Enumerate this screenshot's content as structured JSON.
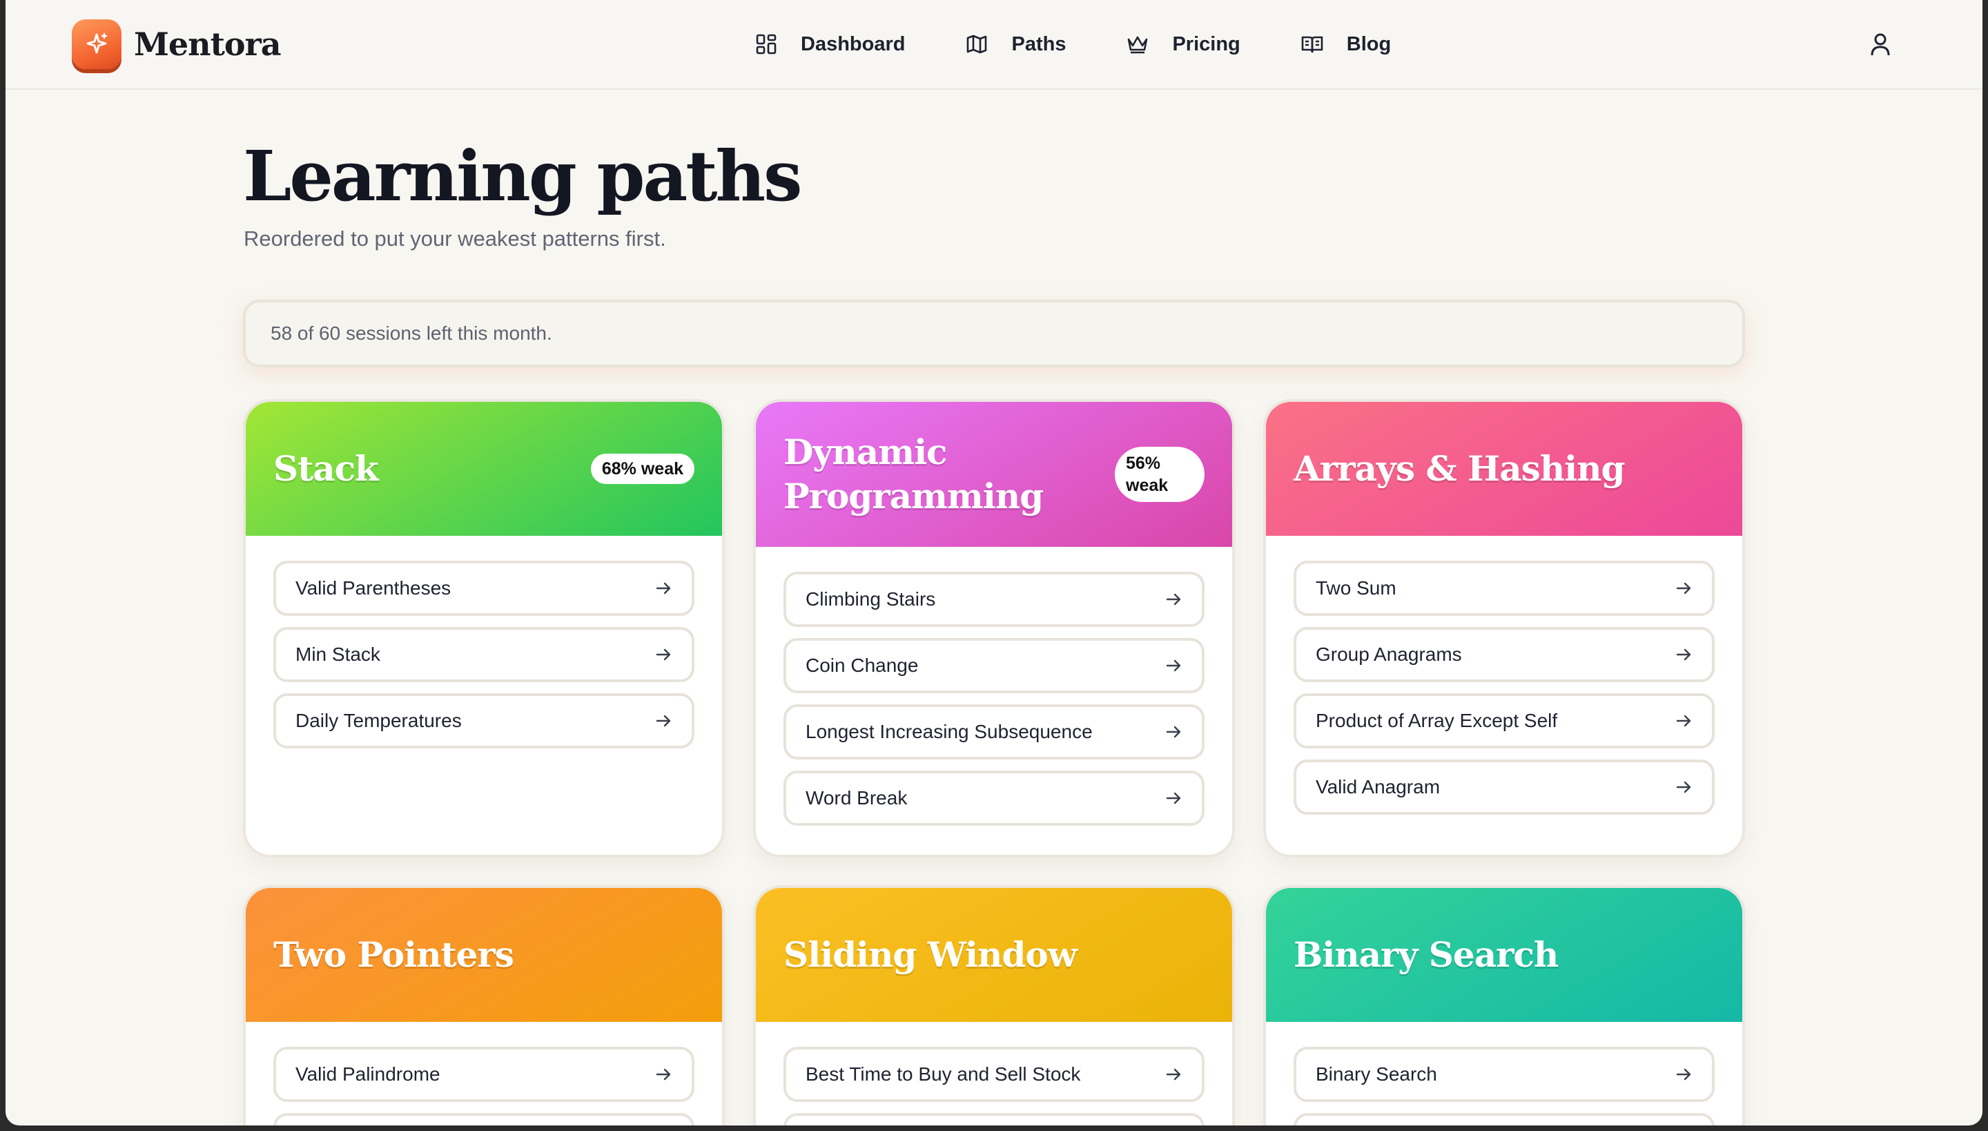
{
  "app": {
    "name": "Mentora",
    "logo_icon": "sparkle-icon",
    "accent": "#f2612d"
  },
  "nav": {
    "items": [
      {
        "label": "Dashboard",
        "icon": "grid-icon"
      },
      {
        "label": "Paths",
        "icon": "map-icon"
      },
      {
        "label": "Pricing",
        "icon": "crown-icon"
      },
      {
        "label": "Blog",
        "icon": "book-icon"
      }
    ],
    "user_icon": "user-icon"
  },
  "page": {
    "title": "Learning paths",
    "subtitle": "Reordered to put your weakest patterns first.",
    "quota": "58 of 60 sessions left this month."
  },
  "paths": [
    {
      "title": "Stack",
      "badge": "68% weak",
      "gradient": [
        "#9ee536",
        "#22c55e"
      ],
      "problems": [
        "Valid Parentheses",
        "Min Stack",
        "Daily Temperatures"
      ]
    },
    {
      "title": "Dynamic Programming",
      "badge_line1": "56%",
      "badge_line2": "weak",
      "gradient": [
        "#e879f9",
        "#d946a8"
      ],
      "problems": [
        "Climbing Stairs",
        "Coin Change",
        "Longest Increasing Subsequence",
        "Word Break"
      ]
    },
    {
      "title": "Arrays & Hashing",
      "gradient": [
        "#fb7185",
        "#ec4899"
      ],
      "problems": [
        "Two Sum",
        "Group Anagrams",
        "Product of Array Except Self",
        "Valid Anagram"
      ]
    },
    {
      "title": "Two Pointers",
      "gradient": [
        "#fb923c",
        "#f59e0b"
      ],
      "problems": [
        "Valid Palindrome"
      ]
    },
    {
      "title": "Sliding Window",
      "gradient": [
        "#fbbf24",
        "#eab308"
      ],
      "problems": [
        "Best Time to Buy and Sell Stock"
      ]
    },
    {
      "title": "Binary Search",
      "gradient": [
        "#34d399",
        "#14b8a6"
      ],
      "problems": [
        "Binary Search"
      ]
    }
  ]
}
